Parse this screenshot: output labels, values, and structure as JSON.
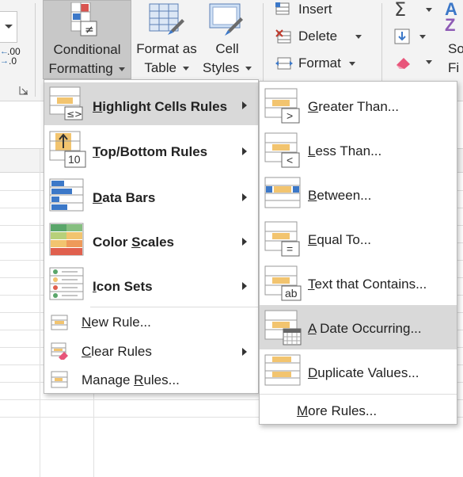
{
  "ribbon": {
    "number_format": {
      "inc_decimal": ".00",
      "dec_decimal": ".0"
    },
    "conditional_formatting": {
      "line1": "Conditional",
      "line2": "Formatting"
    },
    "format_as_table": {
      "line1": "Format as",
      "line2": "Table"
    },
    "cell_styles": {
      "line1": "Cell",
      "line2": "Styles"
    },
    "cells": {
      "insert": "Insert",
      "delete": "Delete",
      "format": "Format"
    },
    "editing": {
      "sort_partial": "So",
      "find_partial": "Fi"
    }
  },
  "main_menu": {
    "items": [
      {
        "label": "Highlight Cells Rules",
        "mnemonic": "H",
        "rest": "ighlight Cells Rules"
      },
      {
        "label": "Top/Bottom Rules",
        "mnemonic": "T",
        "rest": "op/Bottom Rules"
      },
      {
        "label": "Data Bars",
        "mnemonic": "D",
        "rest": "ata Bars"
      },
      {
        "label": "Color Scales",
        "pre": "Color ",
        "mnemonic": "S",
        "rest": "cales"
      },
      {
        "label": "Icon Sets",
        "mnemonic": "I",
        "rest": "con Sets"
      },
      {
        "label": "New Rule...",
        "mnemonic": "N",
        "rest": "ew Rule..."
      },
      {
        "label": "Clear Rules",
        "mnemonic": "C",
        "rest": "lear Rules"
      },
      {
        "label": "Manage Rules...",
        "pre": "Manage ",
        "mnemonic": "R",
        "rest": "ules..."
      }
    ],
    "icon_numbers": {
      "top_bottom": "10"
    }
  },
  "sub_menu": {
    "items": [
      {
        "label": "Greater Than...",
        "mnemonic": "G",
        "rest": "reater Than...",
        "symbol": ">"
      },
      {
        "label": "Less Than...",
        "mnemonic": "L",
        "rest": "ess Than...",
        "symbol": "<"
      },
      {
        "label": "Between...",
        "mnemonic": "B",
        "rest": "etween..."
      },
      {
        "label": "Equal To...",
        "mnemonic": "E",
        "rest": "qual To...",
        "symbol": "="
      },
      {
        "label": "Text that Contains...",
        "mnemonic": "T",
        "rest": "ext that Contains...",
        "symbol": "ab"
      },
      {
        "label": "A Date Occurring...",
        "mnemonic": "A",
        "rest": " Date Occurring..."
      },
      {
        "label": "Duplicate Values...",
        "mnemonic": "D",
        "rest": "uplicate Values..."
      },
      {
        "label": "More Rules...",
        "mnemonic": "M",
        "rest": "ore Rules..."
      }
    ]
  },
  "colors": {
    "highlight": "#d9d9d9",
    "accent_yellow": "#f2c46f",
    "accent_blue": "#3c78c8"
  }
}
